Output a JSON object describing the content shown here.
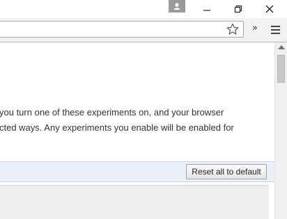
{
  "titlebar": {
    "avatar_icon": "person-icon",
    "minimize_icon": "minimize-icon",
    "maximize_icon": "restore-icon",
    "close_icon": "close-icon"
  },
  "toolbar": {
    "omnibox_value": "",
    "bookmark_icon": "star-icon",
    "overflow_label": "»",
    "menu_icon": "hamburger-menu-icon"
  },
  "content": {
    "warning_line1": "you turn one of these experiments on, and your browser",
    "warning_line2": "cted ways. Any experiments you enable will be enabled for",
    "reset_button_label": "Reset all to default"
  }
}
